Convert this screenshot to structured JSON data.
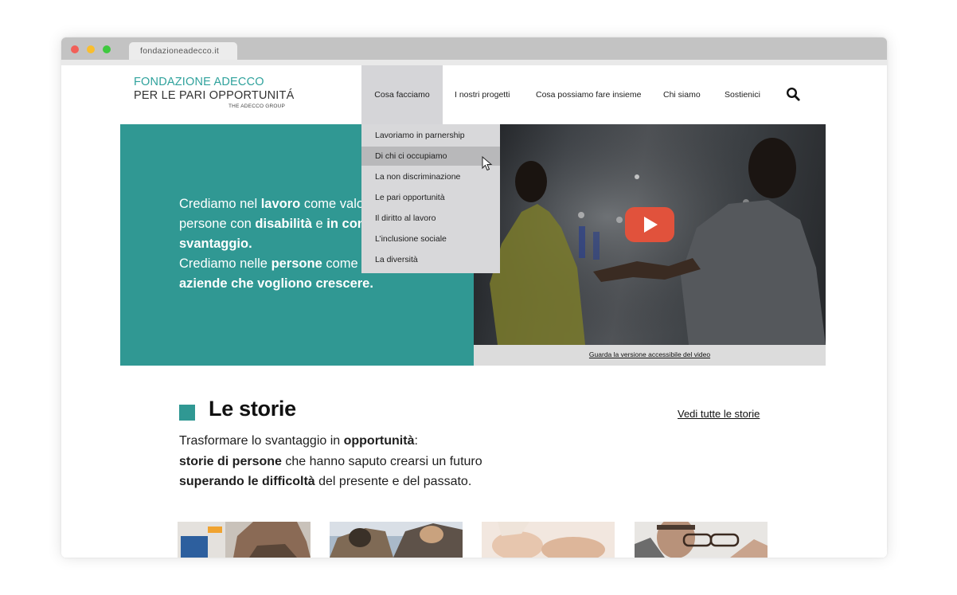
{
  "browser": {
    "tab_title": "fondazioneadecco.it"
  },
  "logo": {
    "line1": "FONDAZIONE ADECCO",
    "line2": "PER LE PARI OPPORTUNITÁ",
    "line3": "THE ADECCO GROUP"
  },
  "nav": {
    "items": [
      {
        "label": "Cosa facciamo",
        "active": true
      },
      {
        "label": "I nostri progetti"
      },
      {
        "label": "Cosa possiamo fare insieme"
      },
      {
        "label": "Chi siamo"
      },
      {
        "label": "Sostienici"
      }
    ],
    "search_icon": "search-icon"
  },
  "dropdown": {
    "items": [
      {
        "label": "Lavoriamo in parnership"
      },
      {
        "label": "Di chi ci occupiamo",
        "hovered": true
      },
      {
        "label": "La non discriminazione"
      },
      {
        "label": "Le pari opportunità"
      },
      {
        "label": "Il diritto al lavoro"
      },
      {
        "label": "L’inclusione sociale"
      },
      {
        "label": "La diversità"
      }
    ]
  },
  "hero": {
    "l1_a": "Crediamo nel ",
    "l1_b": "lavoro",
    "l1_c": " come valo",
    "l2_a": "persone con ",
    "l2_b": "disabilità",
    "l2_c": " e ",
    "l2_d": "in con",
    "l3_b": "svantaggio.",
    "l4_a": "Crediamo nelle ",
    "l4_b": "persone",
    "l4_c": " come r",
    "l5_b": "aziende che vogliono crescere.",
    "video_link": "Guarda la versione accessibile del video"
  },
  "stories": {
    "title": "Le storie",
    "l1_a": "Trasformare lo svantaggio in ",
    "l1_b": "opportunità",
    "l1_c": ":",
    "l2_b": "storie di persone",
    "l2_c": " che hanno saputo crearsi un futuro",
    "l3_b": "superando le difficoltà",
    "l3_c": " del presente e del passato.",
    "see_all": "Vedi tutte le storie"
  },
  "colors": {
    "brand_teal": "#309893",
    "play_button": "#e1523c",
    "dropdown_bg": "#d8d8da",
    "dropdown_hover": "#b8b8ba"
  }
}
